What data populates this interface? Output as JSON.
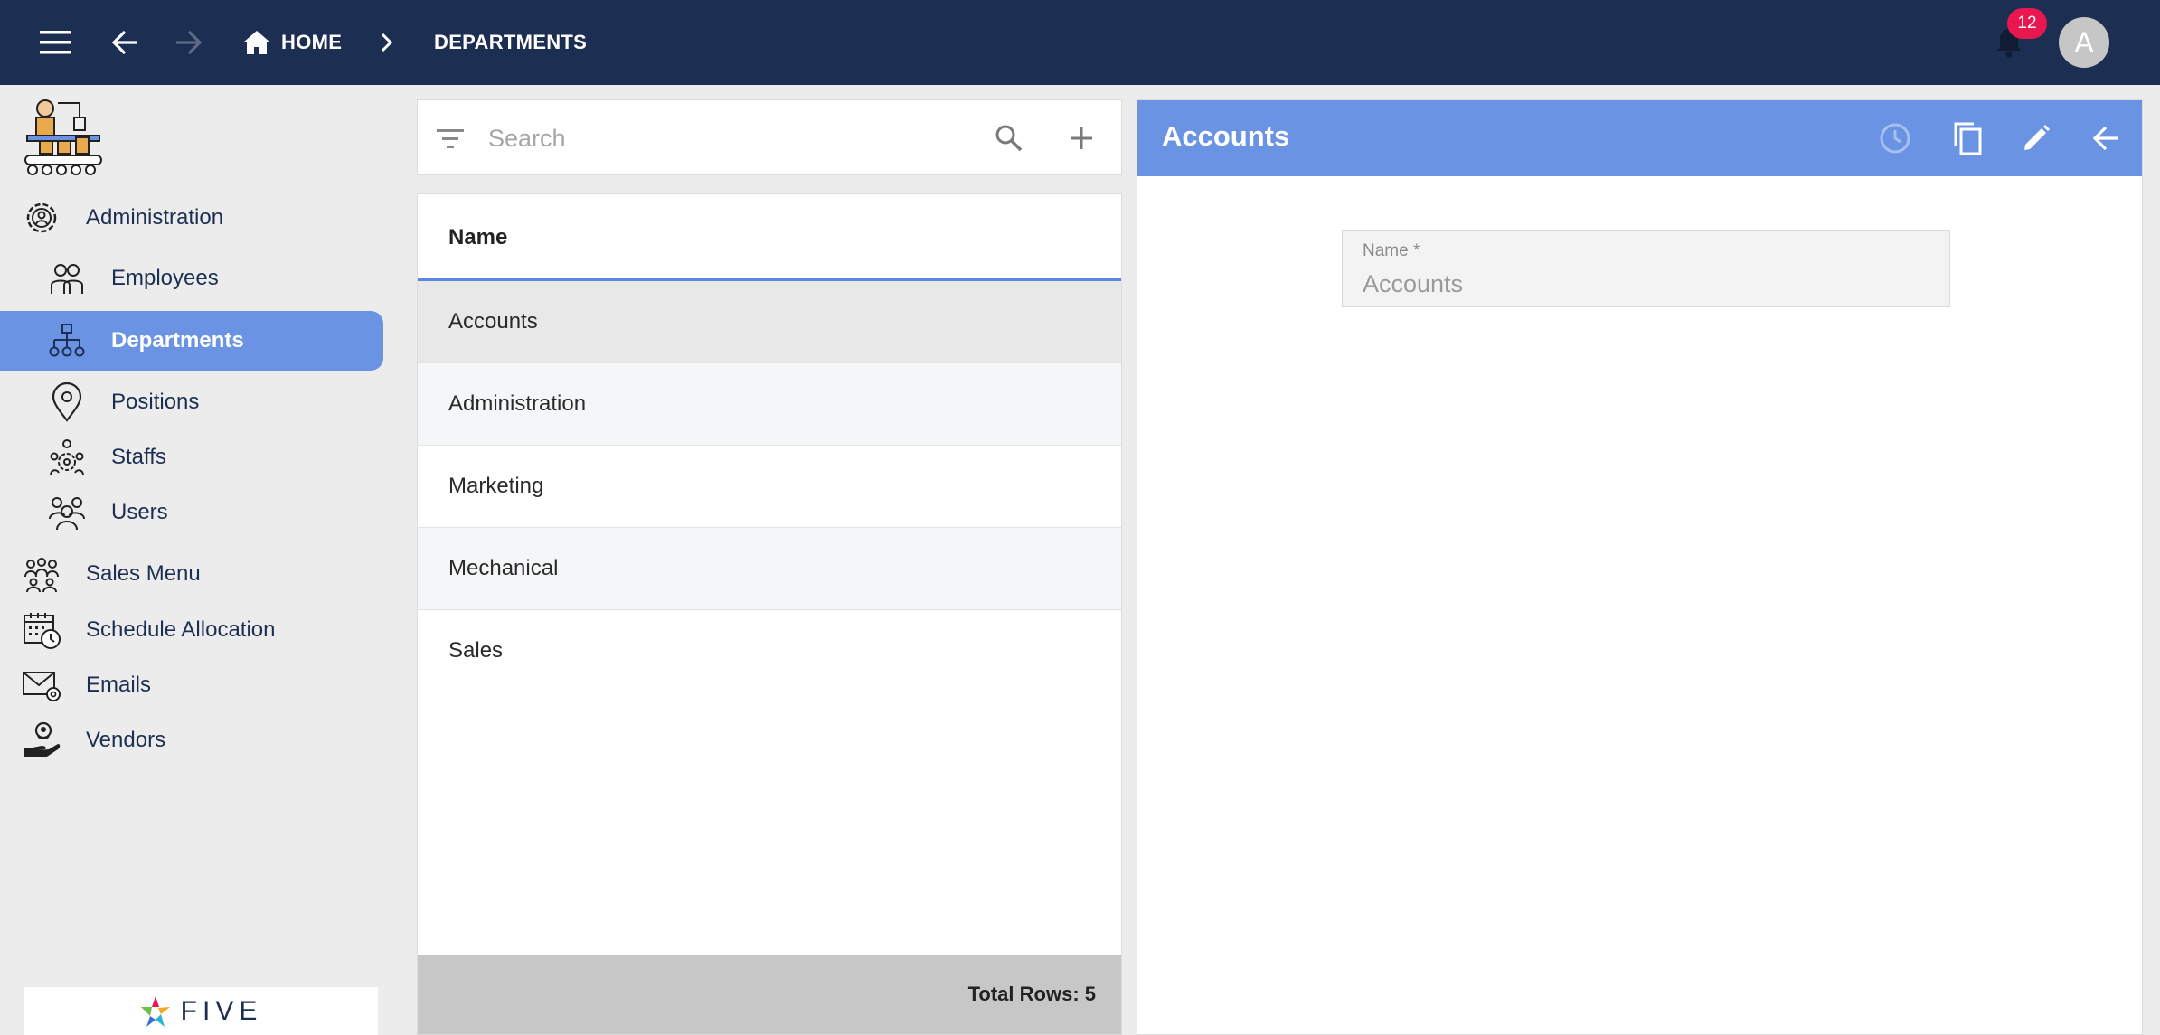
{
  "topbar": {
    "home_label": "HOME",
    "current_label": "DEPARTMENTS",
    "notification_count": "12",
    "avatar_letter": "A"
  },
  "sidebar": {
    "items": [
      {
        "label": "Administration",
        "icon": "gear-user-icon"
      },
      {
        "label": "Employees",
        "icon": "employees-icon"
      },
      {
        "label": "Departments",
        "icon": "org-chart-icon"
      },
      {
        "label": "Positions",
        "icon": "location-pin-icon"
      },
      {
        "label": "Staffs",
        "icon": "staff-icon"
      },
      {
        "label": "Users",
        "icon": "users-icon"
      },
      {
        "label": "Sales Menu",
        "icon": "sales-team-icon"
      },
      {
        "label": "Schedule Allocation",
        "icon": "calendar-clock-icon"
      },
      {
        "label": "Emails",
        "icon": "email-icon"
      },
      {
        "label": "Vendors",
        "icon": "vendor-icon"
      }
    ],
    "footer_logo_text": "FIVE"
  },
  "list": {
    "search_placeholder": "Search",
    "column_header": "Name",
    "rows": [
      "Accounts",
      "Administration",
      "Marketing",
      "Mechanical",
      "Sales"
    ],
    "total_rows_label": "Total Rows: 5"
  },
  "detail": {
    "title": "Accounts",
    "field_label": "Name *",
    "field_value": "Accounts"
  },
  "colors": {
    "topbar": "#1c2f52",
    "accent": "#6a93e3",
    "badge": "#e8174f"
  }
}
